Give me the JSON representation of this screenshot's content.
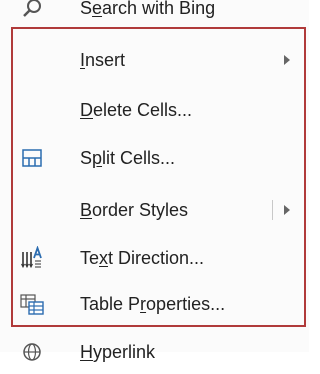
{
  "menu": {
    "items": [
      {
        "id": "search",
        "label_pre": "S",
        "label_u": "e",
        "label_post": "arch with Bing",
        "icon": "search-icon"
      },
      {
        "id": "insert",
        "label_pre": "",
        "label_u": "I",
        "label_post": "nsert",
        "submenu": true
      },
      {
        "id": "delete-cells",
        "label_pre": "",
        "label_u": "D",
        "label_post": "elete Cells..."
      },
      {
        "id": "split-cells",
        "label_pre": "S",
        "label_u": "p",
        "label_post": "lit Cells...",
        "icon": "split-cells-icon"
      },
      {
        "id": "border-styles",
        "label_pre": "",
        "label_u": "B",
        "label_post": "order Styles",
        "submenu": true
      },
      {
        "id": "text-direction",
        "label_pre": "Te",
        "label_u": "x",
        "label_post": "t Direction...",
        "icon": "text-direction-icon"
      },
      {
        "id": "table-properties",
        "label_pre": "Table P",
        "label_u": "r",
        "label_post": "operties...",
        "icon": "table-properties-icon"
      },
      {
        "id": "hyperlink",
        "label_pre": "",
        "label_u": "H",
        "label_post": "yperlink",
        "icon": "globe-link-icon"
      }
    ]
  },
  "colors": {
    "highlight_border": "#b03a3a",
    "icon_blue": "#2b6cb0",
    "menu_bg": "#fbfbfb"
  }
}
